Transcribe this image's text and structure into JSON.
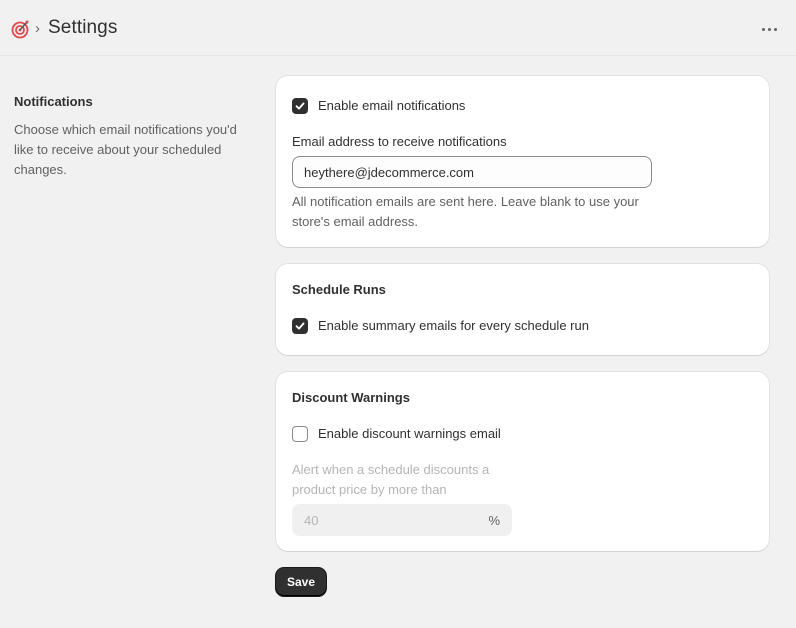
{
  "header": {
    "breadcrumb_separator": "›",
    "title": "Settings",
    "app_icon": "target-icon",
    "more_icon": "more-horizontal-icon"
  },
  "section": {
    "heading": "Notifications",
    "description": "Choose which email notifications you'd like to receive about your scheduled changes."
  },
  "email_card": {
    "enable_label": "Enable email notifications",
    "enable_checked": true,
    "field_label": "Email address to receive notifications",
    "field_value": "heythere@jdecommerce.com",
    "help_text": "All notification emails are sent here. Leave blank to use your store's email address."
  },
  "schedule_card": {
    "title": "Schedule Runs",
    "enable_label": "Enable summary emails for every schedule run",
    "enable_checked": true
  },
  "discount_card": {
    "title": "Discount Warnings",
    "enable_label": "Enable discount warnings email",
    "enable_checked": false,
    "threshold_label": "Alert when a schedule discounts a product price by more than",
    "threshold_value": "40",
    "threshold_suffix": "%"
  },
  "actions": {
    "save_label": "Save"
  },
  "colors": {
    "background": "#f1f1f1",
    "card": "#ffffff",
    "primary_button": "#303030",
    "brand_icon": "#e0484b"
  }
}
